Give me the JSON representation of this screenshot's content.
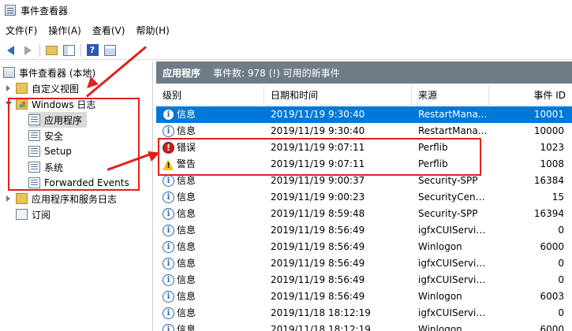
{
  "window": {
    "title": "事件查看器"
  },
  "menu": [
    "文件(F)",
    "操作(A)",
    "查看(V)",
    "帮助(H)"
  ],
  "toolbar": {
    "back_icon": "back-arrow-icon",
    "forward_icon": "forward-arrow-icon",
    "help_label": "?"
  },
  "tree": {
    "root": "事件查看器 (本地)",
    "custom_views": "自定义视图",
    "windows_logs": "Windows 日志",
    "logs": [
      "应用程序",
      "安全",
      "Setup",
      "系统",
      "Forwarded Events"
    ],
    "app_service_logs": "应用程序和服务日志",
    "subscriptions": "订阅"
  },
  "pane": {
    "title": "应用程序",
    "info": "事件数: 978 (!) 可用的新事件"
  },
  "columns": [
    "级别",
    "日期和时间",
    "来源",
    "事件 ID"
  ],
  "rows": [
    {
      "level": "信息",
      "type": "info",
      "date": "2019/11/19 9:30:40",
      "source": "RestartMana...",
      "id": "10001"
    },
    {
      "level": "信息",
      "type": "info",
      "date": "2019/11/19 9:30:40",
      "source": "RestartMana...",
      "id": "10000"
    },
    {
      "level": "错误",
      "type": "error",
      "date": "2019/11/19 9:07:11",
      "source": "Perflib",
      "id": "1023"
    },
    {
      "level": "警告",
      "type": "warn",
      "date": "2019/11/19 9:07:11",
      "source": "Perflib",
      "id": "1008"
    },
    {
      "level": "信息",
      "type": "info",
      "date": "2019/11/19 9:00:37",
      "source": "Security-SPP",
      "id": "16384"
    },
    {
      "level": "信息",
      "type": "info",
      "date": "2019/11/19 9:00:23",
      "source": "SecurityCenter",
      "id": "15"
    },
    {
      "level": "信息",
      "type": "info",
      "date": "2019/11/19 8:59:48",
      "source": "Security-SPP",
      "id": "16394"
    },
    {
      "level": "信息",
      "type": "info",
      "date": "2019/11/19 8:56:49",
      "source": "igfxCUIServic...",
      "id": "0"
    },
    {
      "level": "信息",
      "type": "info",
      "date": "2019/11/19 8:56:49",
      "source": "Winlogon",
      "id": "6000"
    },
    {
      "level": "信息",
      "type": "info",
      "date": "2019/11/19 8:56:49",
      "source": "igfxCUIServic...",
      "id": "0"
    },
    {
      "level": "信息",
      "type": "info",
      "date": "2019/11/19 8:56:49",
      "source": "igfxCUIServic...",
      "id": "0"
    },
    {
      "level": "信息",
      "type": "info",
      "date": "2019/11/19 8:56:49",
      "source": "Winlogon",
      "id": "6003"
    },
    {
      "level": "信息",
      "type": "info",
      "date": "2019/11/18 18:12:19",
      "source": "igfxCUIServic...",
      "id": "0"
    },
    {
      "level": "信息",
      "type": "info",
      "date": "2019/11/18 18:12:19",
      "source": "Winlogon",
      "id": "6000"
    }
  ],
  "colors": {
    "selection": "#0078d7",
    "annotation": "#e0201b",
    "pane_header": "#6f7c88"
  }
}
